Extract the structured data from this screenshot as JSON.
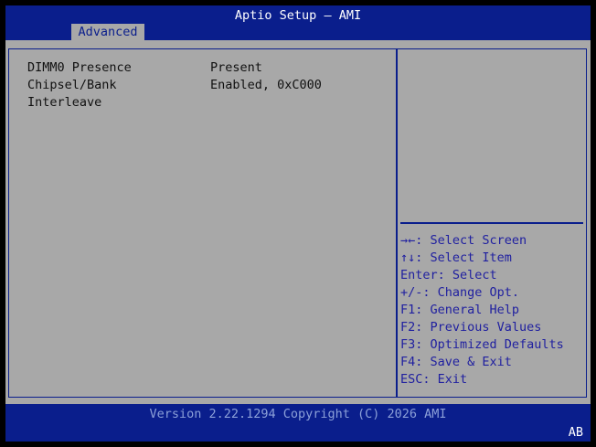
{
  "header": {
    "title": "Aptio Setup – AMI",
    "tab_label": "Advanced"
  },
  "settings": [
    {
      "label": "DIMM0 Presence",
      "value": "Present"
    },
    {
      "label": "Chipsel/Bank",
      "value": "Enabled, 0xC000"
    },
    {
      "label": "Interleave",
      "value": ""
    }
  ],
  "help": [
    "→←: Select Screen",
    "↑↓: Select Item",
    "Enter: Select",
    "+/-: Change Opt.",
    "F1: General Help",
    "F2: Previous Values",
    "F3: Optimized Defaults",
    "F4: Save & Exit",
    "ESC: Exit"
  ],
  "footer": {
    "version_text": "Version 2.22.1294 Copyright (C) 2026 AMI",
    "badge": "AB"
  },
  "colors": {
    "bar_blue": "#0a1e8c",
    "panel_gray": "#a8a8a8",
    "help_text": "#2020a0",
    "footer_text": "#8ca0d8"
  }
}
